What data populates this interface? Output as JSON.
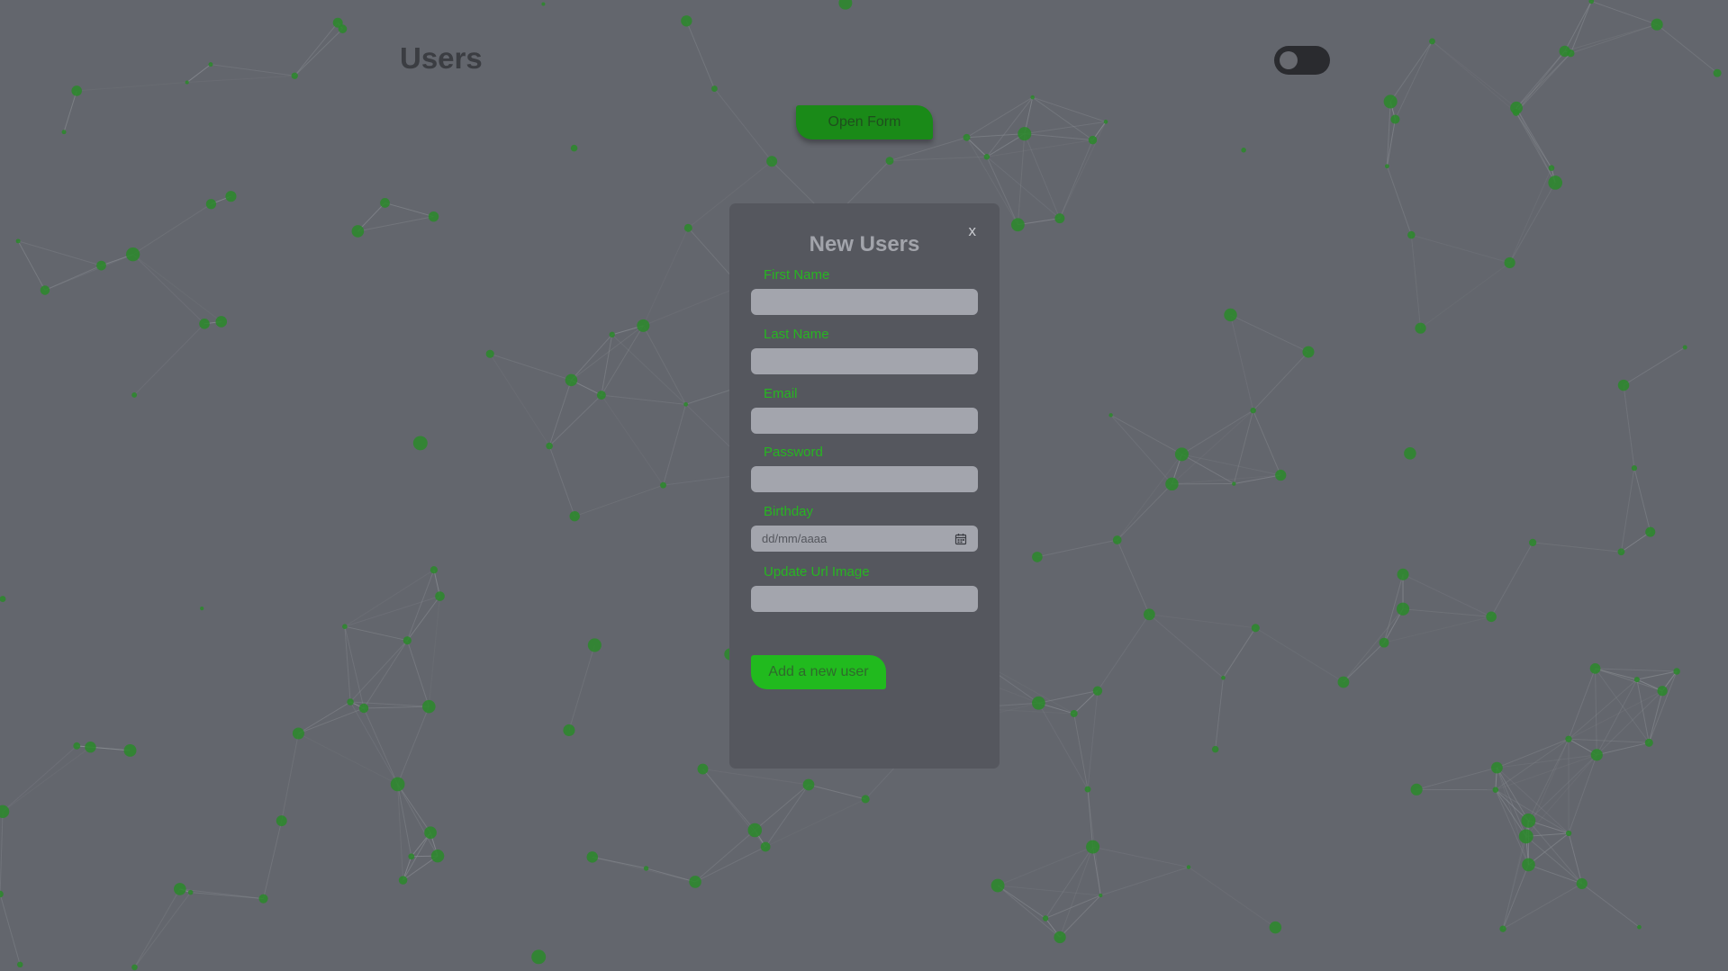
{
  "header": {
    "title": "Users",
    "theme_toggle": {
      "state": "off"
    },
    "open_form_label": "Open Form"
  },
  "modal": {
    "title": "New Users",
    "close_label": "x",
    "fields": [
      {
        "label": "First Name",
        "value": "",
        "type": "text"
      },
      {
        "label": "Last Name",
        "value": "",
        "type": "text"
      },
      {
        "label": "Email",
        "value": "",
        "type": "email"
      },
      {
        "label": "Password",
        "value": "",
        "type": "password"
      },
      {
        "label": "Birthday",
        "placeholder": "dd/mm/aaaa",
        "type": "date"
      },
      {
        "label": "Update Url Image",
        "value": "",
        "type": "text"
      }
    ],
    "submit_label": "Add a new user"
  },
  "icons": {
    "calendar": "calendar-icon"
  },
  "colors": {
    "background": "#63666d",
    "modal": "#55575e",
    "accent_green": "#21ba1e",
    "node_green": "#2a8a2a",
    "input": "#a3a5ad"
  }
}
